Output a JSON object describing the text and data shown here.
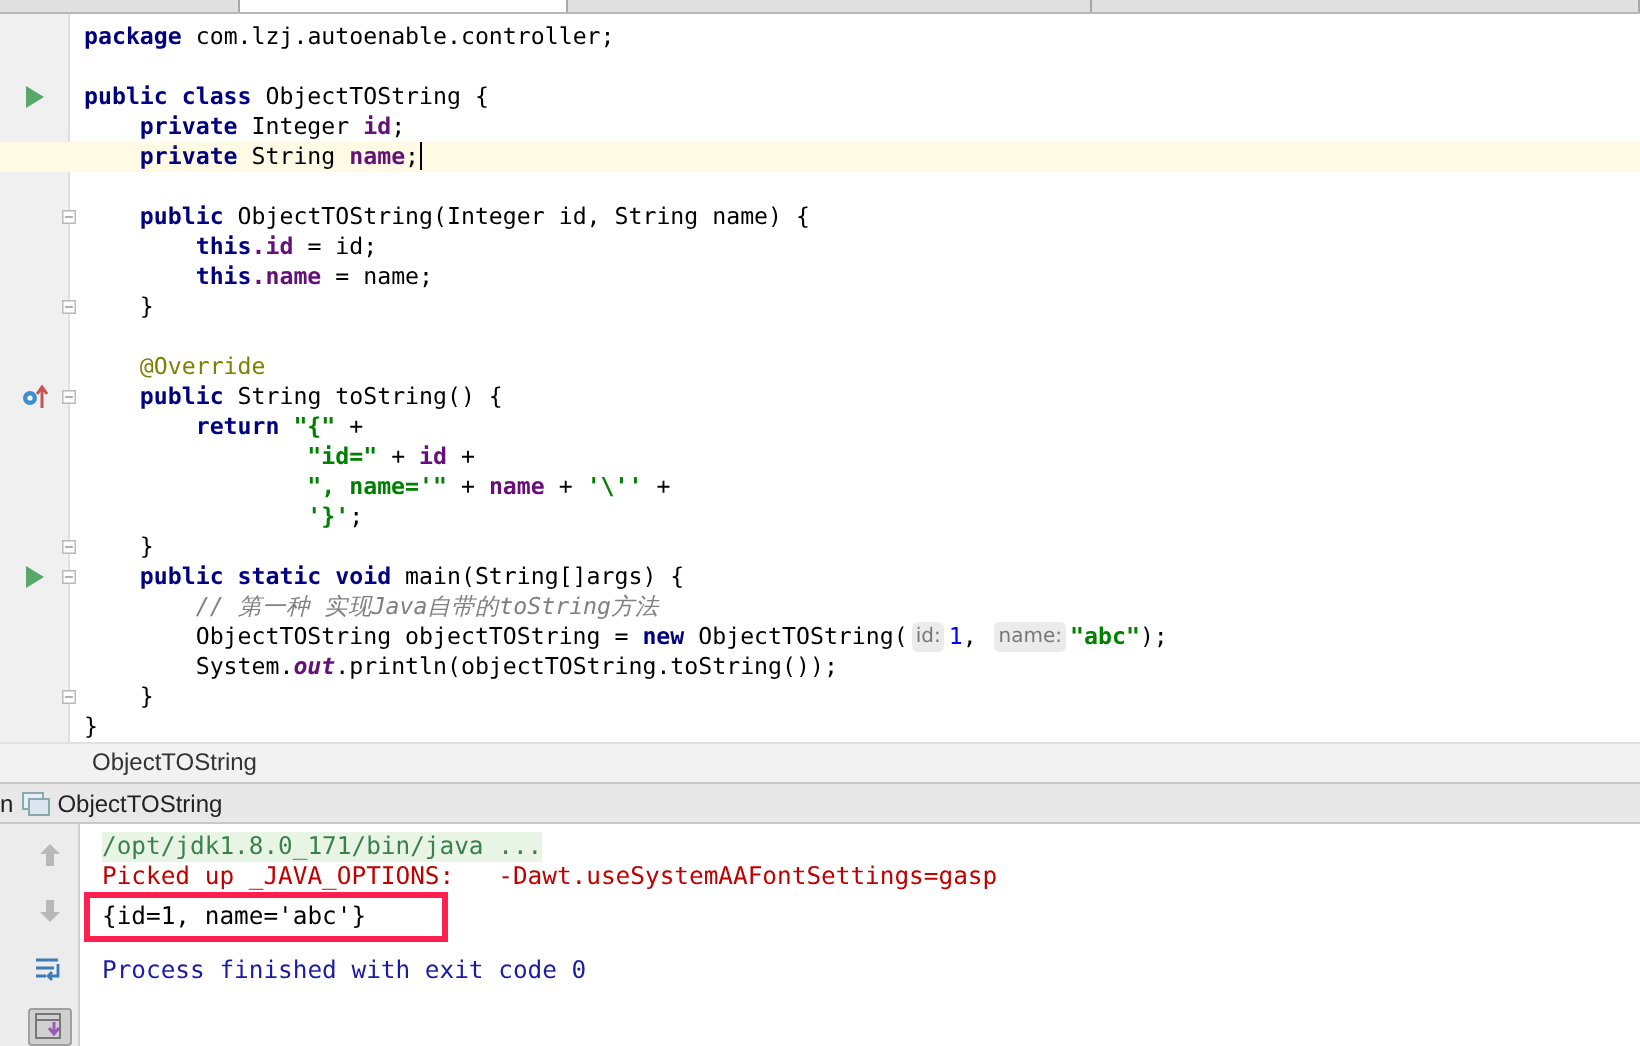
{
  "tabs": [
    {
      "selected": false
    },
    {
      "selected": true
    },
    {
      "selected": false
    },
    {
      "selected": false
    }
  ],
  "editor": {
    "lines": [
      {
        "kind": "code",
        "fold": false,
        "current": false,
        "tokens": [
          {
            "kind": "kw",
            "text": "package"
          },
          {
            "kind": "plain",
            "text": " com.lzj.autoenable.controller;"
          }
        ]
      },
      {
        "kind": "blank"
      },
      {
        "kind": "code",
        "gutter": {
          "kind": "run"
        },
        "fold": false,
        "current": false,
        "tokens": [
          {
            "kind": "kw",
            "text": "public class"
          },
          {
            "kind": "plain",
            "text": " ObjectTOString {"
          }
        ]
      },
      {
        "kind": "code",
        "fold": false,
        "current": false,
        "tokens": [
          {
            "kind": "kw",
            "text": "    private"
          },
          {
            "kind": "plain",
            "text": " Integer "
          },
          {
            "kind": "field",
            "text": "id"
          },
          {
            "kind": "plain",
            "text": ";"
          }
        ]
      },
      {
        "kind": "code",
        "fold": false,
        "current": true,
        "tokens": [
          {
            "kind": "kw",
            "text": "    private"
          },
          {
            "kind": "plain",
            "text": " String "
          },
          {
            "kind": "field",
            "text": "name"
          },
          {
            "kind": "plain",
            "text": ";"
          }
        ]
      },
      {
        "kind": "blank"
      },
      {
        "kind": "code",
        "fold": true,
        "current": false,
        "tokens": [
          {
            "kind": "kw",
            "text": "    public"
          },
          {
            "kind": "plain",
            "text": " ObjectTOString(Integer id, String name) {"
          }
        ]
      },
      {
        "kind": "code",
        "fold": false,
        "current": false,
        "tokens": [
          {
            "kind": "kw",
            "text": "        this"
          },
          {
            "kind": "field",
            "text": ".id"
          },
          {
            "kind": "plain",
            "text": " = id;"
          }
        ]
      },
      {
        "kind": "code",
        "fold": false,
        "current": false,
        "tokens": [
          {
            "kind": "kw",
            "text": "        this"
          },
          {
            "kind": "field",
            "text": ".name"
          },
          {
            "kind": "plain",
            "text": " = name;"
          }
        ]
      },
      {
        "kind": "code",
        "fold": true,
        "current": false,
        "tokens": [
          {
            "kind": "plain",
            "text": "    }"
          }
        ]
      },
      {
        "kind": "blank"
      },
      {
        "kind": "code",
        "fold": false,
        "current": false,
        "tokens": [
          {
            "kind": "annotation",
            "text": "    @Override"
          }
        ]
      },
      {
        "kind": "code",
        "gutter": {
          "kind": "override"
        },
        "fold": true,
        "current": false,
        "tokens": [
          {
            "kind": "kw",
            "text": "    public"
          },
          {
            "kind": "plain",
            "text": " String toString() {"
          }
        ]
      },
      {
        "kind": "code",
        "fold": false,
        "current": false,
        "tokens": [
          {
            "kind": "kw",
            "text": "        return "
          },
          {
            "kind": "string",
            "text": "\"{\""
          },
          {
            "kind": "plain",
            "text": " +"
          }
        ]
      },
      {
        "kind": "code",
        "fold": false,
        "current": false,
        "tokens": [
          {
            "kind": "string",
            "text": "                \"id=\""
          },
          {
            "kind": "plain",
            "text": " + "
          },
          {
            "kind": "field",
            "text": "id"
          },
          {
            "kind": "plain",
            "text": " +"
          }
        ]
      },
      {
        "kind": "code",
        "fold": false,
        "current": false,
        "tokens": [
          {
            "kind": "string",
            "text": "                \", name='\""
          },
          {
            "kind": "plain",
            "text": " + "
          },
          {
            "kind": "field",
            "text": "name"
          },
          {
            "kind": "plain",
            "text": " + "
          },
          {
            "kind": "string",
            "text": "'\\''"
          },
          {
            "kind": "plain",
            "text": " +"
          }
        ]
      },
      {
        "kind": "code",
        "fold": false,
        "current": false,
        "tokens": [
          {
            "kind": "string",
            "text": "                '}'"
          },
          {
            "kind": "plain",
            "text": ";"
          }
        ]
      },
      {
        "kind": "code",
        "fold": true,
        "current": false,
        "tokens": [
          {
            "kind": "plain",
            "text": "    }"
          }
        ]
      },
      {
        "kind": "code",
        "gutter": {
          "kind": "run"
        },
        "fold": true,
        "current": false,
        "tokens": [
          {
            "kind": "kw",
            "text": "    public static void"
          },
          {
            "kind": "plain",
            "text": " main(String[]args) {"
          }
        ]
      },
      {
        "kind": "code",
        "fold": false,
        "current": false,
        "tokens": [
          {
            "kind": "comment",
            "text": "        // 第一种 实现Java自带的toString方法"
          }
        ]
      },
      {
        "kind": "code",
        "fold": false,
        "current": false,
        "tokens": [
          {
            "kind": "plain",
            "text": "        ObjectTOString objectTOString = "
          },
          {
            "kind": "kw",
            "text": "new"
          },
          {
            "kind": "plain",
            "text": " ObjectTOString("
          },
          {
            "kind": "hint",
            "text": "id:"
          },
          {
            "kind": "number",
            "text": "1"
          },
          {
            "kind": "plain",
            "text": ", "
          },
          {
            "kind": "hint",
            "text": "name:"
          },
          {
            "kind": "string",
            "text": "\"abc\""
          },
          {
            "kind": "plain",
            "text": ");"
          }
        ]
      },
      {
        "kind": "code",
        "fold": false,
        "current": false,
        "tokens": [
          {
            "kind": "plain",
            "text": "        System."
          },
          {
            "kind": "static",
            "text": "out"
          },
          {
            "kind": "plain",
            "text": ".println(objectTOString.toString());"
          }
        ]
      },
      {
        "kind": "code",
        "fold": true,
        "current": false,
        "tokens": [
          {
            "kind": "plain",
            "text": "    }"
          }
        ]
      },
      {
        "kind": "code",
        "fold": false,
        "current": false,
        "tokens": [
          {
            "kind": "plain",
            "text": "}"
          }
        ]
      }
    ]
  },
  "breadcrumb": "ObjectTOString",
  "run_panel": {
    "label_cut": "n",
    "config": "ObjectTOString",
    "toolbar": [
      {
        "kind": "up",
        "selected": false
      },
      {
        "kind": "down",
        "selected": false
      },
      {
        "kind": "wrap",
        "selected": false
      },
      {
        "kind": "scroll-end",
        "selected": true
      }
    ],
    "console": [
      {
        "kind": "command",
        "text": "/opt/jdk1.8.0_171/bin/java ...",
        "highlighted": false
      },
      {
        "kind": "stderr",
        "text": "Picked up _JAVA_OPTIONS:   -Dawt.useSystemAAFontSettings=gasp",
        "highlighted": false
      },
      {
        "kind": "stdout",
        "text": "{id=1, name='abc'}",
        "highlighted": true
      },
      {
        "kind": "exit",
        "text": "Process finished with exit code 0",
        "highlighted": false
      }
    ]
  }
}
